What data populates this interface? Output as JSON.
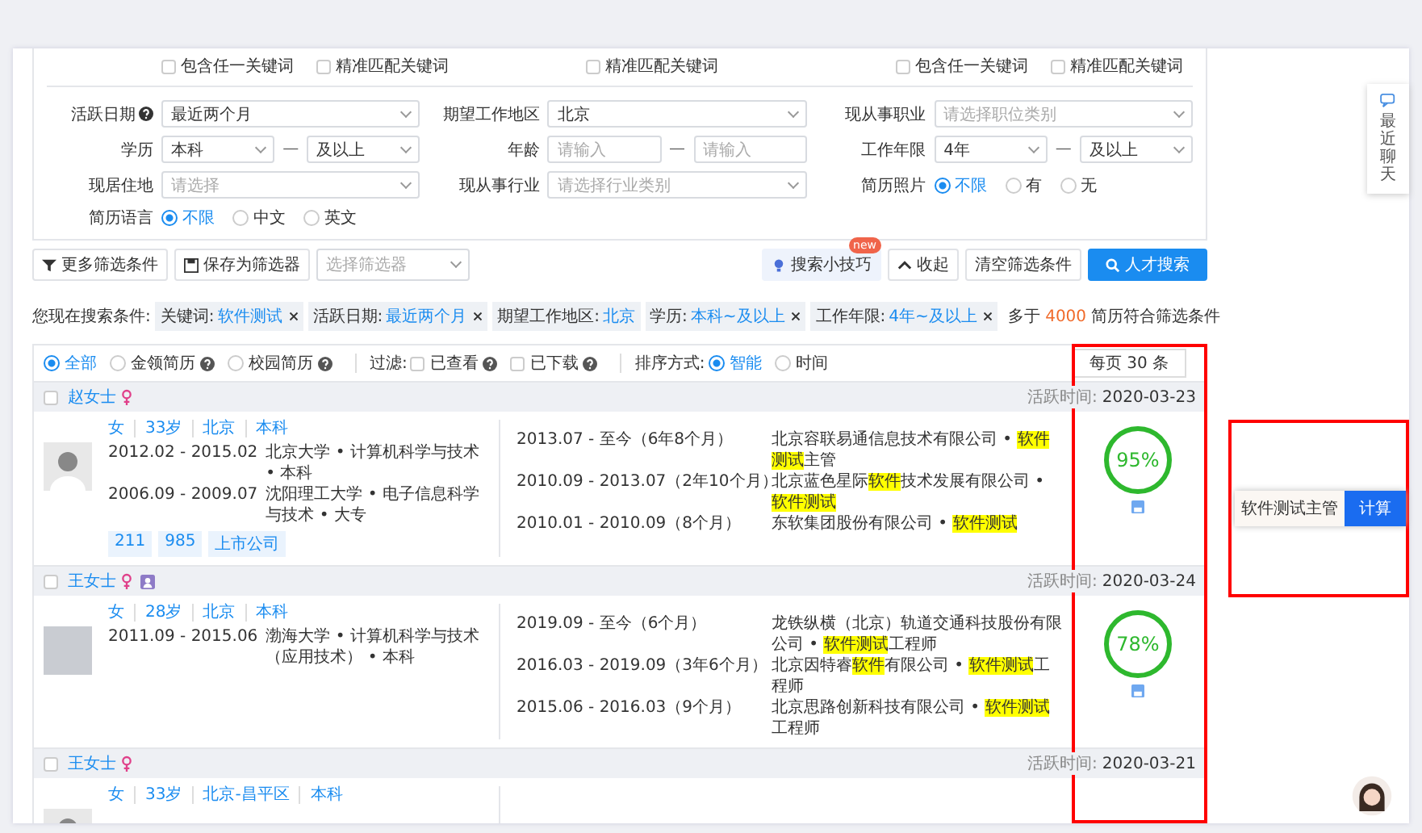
{
  "keyword_groups": [
    [
      {
        "label": "包含任一关键词",
        "checked": false
      },
      {
        "label": "精准匹配关键词",
        "checked": false
      }
    ],
    [
      {
        "label": "精准匹配关键词",
        "checked": false
      }
    ],
    [
      {
        "label": "包含任一关键词",
        "checked": false
      },
      {
        "label": "精准匹配关键词",
        "checked": false
      }
    ]
  ],
  "filters": [
    {
      "label": "活跃日期",
      "help": true,
      "kind": "select",
      "value": "最近两个月"
    },
    {
      "label": "期望工作地区",
      "kind": "select",
      "value": "北京"
    },
    {
      "label": "现从事职业",
      "kind": "select",
      "placeholder": "请选择职位类别"
    },
    {
      "label": "学历",
      "kind": "select_range",
      "from": {
        "value": "本科"
      },
      "separator": "—",
      "to": {
        "value": "及以上"
      }
    },
    {
      "label": "年龄",
      "kind": "input_range",
      "from": {
        "placeholder": "请输入"
      },
      "separator": "—",
      "to": {
        "placeholder": "请输入"
      }
    },
    {
      "label": "工作年限",
      "kind": "select_range",
      "from": {
        "value": "4年"
      },
      "separator": "—",
      "to": {
        "value": "及以上"
      }
    },
    {
      "label": "现居住地",
      "kind": "select",
      "placeholder": "请选择"
    },
    {
      "label": "现从事行业",
      "kind": "select",
      "placeholder": "请选择行业类别"
    },
    {
      "label": "简历照片",
      "kind": "radio",
      "options": [
        {
          "label": "不限",
          "selected": true
        },
        {
          "label": "有",
          "selected": false
        },
        {
          "label": "无",
          "selected": false
        }
      ]
    },
    {
      "label": "简历语言",
      "kind": "radio",
      "options": [
        {
          "label": "不限",
          "selected": true
        },
        {
          "label": "中文",
          "selected": false
        },
        {
          "label": "英文",
          "selected": false
        }
      ]
    }
  ],
  "toolbar": {
    "more_filters": "更多筛选条件",
    "save_filter": "保存为筛选器",
    "filter_select": {
      "placeholder": "选择筛选器"
    },
    "tips": {
      "label": "搜索小技巧",
      "badge": "new"
    },
    "collapse": "收起",
    "clear": "清空筛选条件",
    "search": "人才搜索"
  },
  "conditions": {
    "label": "您现在搜索条件:",
    "tags": [
      {
        "key": "关键词:",
        "value": "软件测试",
        "removable": true
      },
      {
        "key": "活跃日期:",
        "value": "最近两个月",
        "removable": true
      },
      {
        "key": "期望工作地区:",
        "value": "北京",
        "removable": false
      },
      {
        "key": "学历:",
        "value": "本科~及以上",
        "removable": true
      },
      {
        "key": "工作年限:",
        "value": "4年~及以上",
        "removable": true
      }
    ],
    "prefix": "多于",
    "count": "4000",
    "suffix": "简历符合筛选条件"
  },
  "options": {
    "types": [
      {
        "label": "全部",
        "selected": true
      },
      {
        "label": "金领简历",
        "selected": false,
        "help": true
      },
      {
        "label": "校园简历",
        "selected": false,
        "help": true
      }
    ],
    "filter_label": "过滤:",
    "filter_options": [
      {
        "label": "已查看",
        "checked": false,
        "help": true
      },
      {
        "label": "已下载",
        "checked": false,
        "help": true
      }
    ],
    "sort_label": "排序方式:",
    "sort_options": [
      {
        "label": "智能",
        "selected": true
      },
      {
        "label": "时间",
        "selected": false
      }
    ],
    "page_size": "每页 30 条"
  },
  "candidates": [
    {
      "name": "赵女士",
      "checked": false,
      "female": true,
      "verified": false,
      "active_label": "活跃时间:",
      "active_date": "2020-03-23",
      "has_photo": false,
      "info": [
        "女",
        "33岁",
        "北京",
        "本科"
      ],
      "education": [
        {
          "period": "2012.02 - 2015.02",
          "detail": "北京大学 • 计算机科学与技术 • 本科"
        },
        {
          "period": "2006.09 - 2009.07",
          "detail": "沈阳理工大学 • 电子信息科学与技术 • 大专"
        }
      ],
      "tags": [
        "211",
        "985",
        "上市公司"
      ],
      "experience": [
        {
          "period": "2013.07 - 至今（6年8个月）",
          "detail": "北京容联易通信息技术有限公司 • **软件测试**主管"
        },
        {
          "period": "2010.09 - 2013.07（2年10个月）",
          "detail": "北京蓝色星际**软件**技术发展有限公司 • **软件测试**"
        },
        {
          "period": "2010.01 - 2010.09（8个月）",
          "detail": "东软集团股份有限公司 • **软件测试**"
        }
      ],
      "match": "95%"
    },
    {
      "name": "王女士",
      "checked": false,
      "female": true,
      "verified": true,
      "active_label": "活跃时间:",
      "active_date": "2020-03-24",
      "has_photo": true,
      "info": [
        "女",
        "28岁",
        "北京",
        "本科"
      ],
      "education": [
        {
          "period": "2011.09 - 2015.06",
          "detail": "渤海大学 • 计算机科学与技术（应用技术） • 本科"
        }
      ],
      "experience": [
        {
          "period": "2019.09 - 至今（6个月）",
          "detail": "龙铁纵横（北京）轨道交通科技股份有限公司 • **软件测试**工程师"
        },
        {
          "period": "2016.03 - 2019.09（3年6个月）",
          "detail": "北京因特睿**软件**有限公司 • **软件测试**工程师"
        },
        {
          "period": "2015.06 - 2016.03（9个月）",
          "detail": "北京思路创新科技有限公司 • **软件测试**工程师"
        }
      ],
      "match": "78%"
    },
    {
      "name": "王女士",
      "checked": false,
      "female": true,
      "verified": false,
      "active_label": "活跃时间:",
      "active_date": "2020-03-21",
      "has_photo": false,
      "info": [
        "女",
        "33岁",
        "北京-昌平区",
        "本科"
      ]
    }
  ],
  "side_tab": {
    "label": "最近聊天"
  },
  "calculator": {
    "value": "软件测试主管",
    "button": "计算"
  }
}
